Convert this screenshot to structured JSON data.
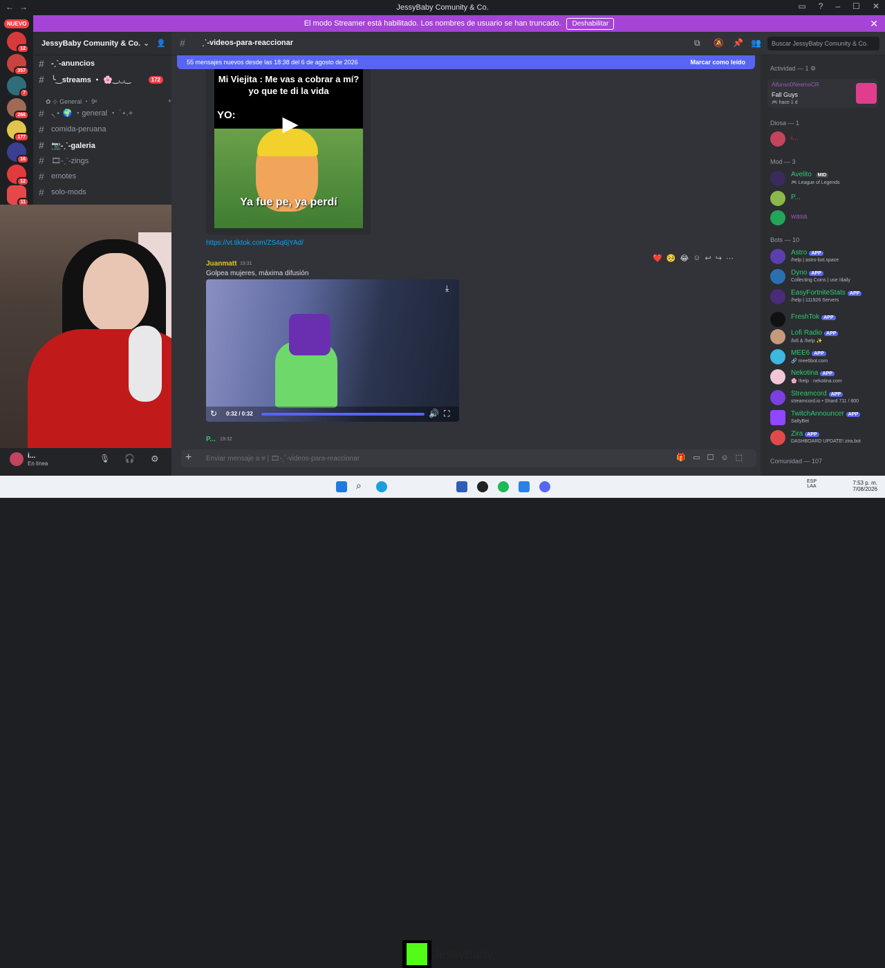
{
  "window": {
    "title": "JessyBaby Comunity & Co."
  },
  "streamer_banner": {
    "text": "El modo Streamer está habilitado. Los nombres de usuario se han truncado.",
    "button": "Deshabilitar"
  },
  "rail": {
    "new_label": "NUEVO",
    "badges": [
      "12",
      "357",
      "7",
      "266",
      "177",
      "16",
      "12",
      "11"
    ]
  },
  "server": {
    "name": "JessyBaby Comunity & Co."
  },
  "channels": [
    {
      "label": "-ˏˋ-anuncios",
      "bold": true
    },
    {
      "label": "╰‿streams ・ 🌸‿◡‿",
      "bold": true,
      "badge": "172"
    },
    {
      "label": "✿ ⊹ General ・ 9ᵉ",
      "category": true
    },
    {
      "label": "৲⋆ 🌍 ・general ・ ˙⋆.+"
    },
    {
      "label": "comida-peruana"
    },
    {
      "label": "📷-ˏˋ-galeria",
      "bold": true
    },
    {
      "label": "🎞-ˏˋ-zings"
    },
    {
      "label": "emotes"
    },
    {
      "label": "solo-mods"
    }
  ],
  "user_panel": {
    "name": "i...",
    "status": "En línea"
  },
  "chan_header": {
    "name": "ˏˋ-videos-para-reaccionar",
    "search_placeholder": "Buscar JessyBaby Comunity & Co."
  },
  "new_messages": {
    "text": "55 mensajes nuevos desde las 18:38 del 6 de agosto de 2026",
    "action": "Marcar como leído"
  },
  "messages": {
    "meme": {
      "top_text": "Mi Viejita : Me vas a cobrar a mí? yo que te di la vida",
      "yo": "YO:",
      "bottom_text": "Ya fue pe, ya perdí"
    },
    "link": "https://vt.tiktok.com/ZS4q6jYAd/",
    "juanmatt": {
      "author": "Juanmatt",
      "time": "19:31",
      "text": "Golpea mujeres, máxima difusión",
      "video_time": "0:32 / 0:32"
    },
    "next": {
      "author": "P...",
      "time": "19:32"
    }
  },
  "input": {
    "placeholder": "Enviar mensaje a # | 🎞-ˏˋ-videos-para-reaccionar"
  },
  "members": {
    "activity_head": "Actividad — 1 ⚙",
    "activity": {
      "name": "Alfunso0NeemoCR",
      "game": "Fall Guys",
      "time": "🎮 hace 1 d"
    },
    "diosa_head": "Diosa — 1",
    "diosa": [
      {
        "name": "i...",
        "color": "#e91e63"
      }
    ],
    "mod_head": "Mod — 3",
    "mods": [
      {
        "name": "Avelito",
        "tag": "MID",
        "sub": "🎮 League of Legends",
        "color": "#2ecc71"
      },
      {
        "name": "P...",
        "color": "#2ecc71"
      },
      {
        "name": "wasa",
        "color": "#9b59b6"
      }
    ],
    "bots_head": "Bots — 10",
    "bots": [
      {
        "name": "Astro",
        "sub": "/help | astro-bot.space",
        "color": "#2ecc71"
      },
      {
        "name": "Dyno",
        "sub": "Collecting Coins | use /daily",
        "color": "#2ecc71"
      },
      {
        "name": "EasyFortniteStats",
        "sub": "/help | 111926 Servers",
        "color": "#2ecc71"
      },
      {
        "name": "FreshTok",
        "sub": "",
        "color": "#2ecc71"
      },
      {
        "name": "Lofi Radio",
        "sub": "/lofi & /help ✨",
        "color": "#2ecc71"
      },
      {
        "name": "MEE6",
        "sub": "🔗 mee6bot.com",
        "color": "#2ecc71"
      },
      {
        "name": "Nekotina",
        "sub": "🌸 !help · nekotina.com",
        "color": "#2ecc71"
      },
      {
        "name": "Streamcord",
        "sub": "streamcord.io • Shard 711 / 800",
        "color": "#2ecc71"
      },
      {
        "name": "TwitchAnnouncer",
        "sub": "SaltyBet",
        "color": "#2ecc71"
      },
      {
        "name": "Zira",
        "sub": "DASHBOARD UPDATE! zira.bot",
        "color": "#2ecc71"
      }
    ],
    "app_label": "APP",
    "comunidad_head": "Comunidad — 107"
  },
  "taskbar": {
    "lang": "ESP LAA",
    "time": "7:53 p. m.",
    "date": "7/08/2026",
    "overlay": "JessyBaby"
  }
}
